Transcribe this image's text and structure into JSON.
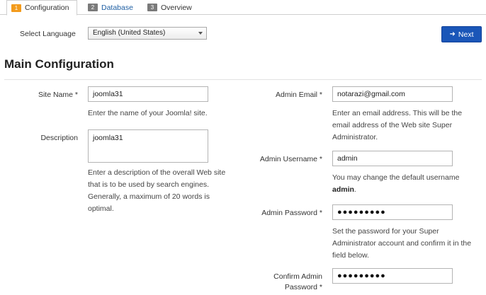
{
  "tabs": [
    {
      "num": "1",
      "label": "Configuration",
      "active": true
    },
    {
      "num": "2",
      "label": "Database",
      "active": false
    },
    {
      "num": "3",
      "label": "Overview",
      "active": false
    }
  ],
  "language": {
    "label": "Select Language",
    "selected": "English (United States)"
  },
  "next_button": {
    "label": "Next",
    "icon": "arrow-right-icon",
    "color": "#1a56b8"
  },
  "main": {
    "title": "Main Configuration"
  },
  "form": {
    "site_name": {
      "label": "Site Name *",
      "value": "joomla31",
      "hint": "Enter the name of your Joomla! site."
    },
    "description": {
      "label": "Description",
      "value": "joomla31",
      "hint": "Enter a description of the overall Web site that is to be used by search engines. Generally, a maximum of 20 words is optimal."
    },
    "admin_email": {
      "label": "Admin Email *",
      "value": "notarazi@gmail.com",
      "hint": "Enter an email address. This will be the email address of the Web site Super Administrator."
    },
    "admin_username": {
      "label": "Admin Username *",
      "value": "admin",
      "hint_prefix": "You may change the default username",
      "hint_bold": "admin",
      "hint_suffix": "."
    },
    "admin_password": {
      "label": "Admin Password *",
      "value": "●●●●●●●●●",
      "hint": "Set the password for your Super Administrator account and confirm it in the field below."
    },
    "confirm_password": {
      "label_line1": "Confirm Admin",
      "label_line2": "Password *",
      "value": "●●●●●●●●●"
    }
  }
}
